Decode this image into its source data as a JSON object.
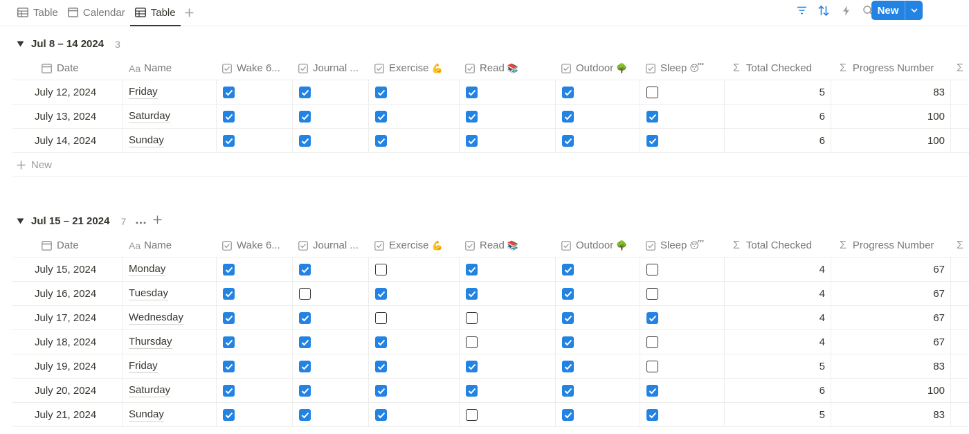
{
  "tabs": [
    {
      "label": "Table",
      "icon": "table-icon",
      "active": false
    },
    {
      "label": "Calendar",
      "icon": "calendar-icon",
      "active": false
    },
    {
      "label": "Table",
      "icon": "table-icon",
      "active": true
    }
  ],
  "toolbar": {
    "new_label": "New"
  },
  "columns": {
    "date": "Date",
    "name_prefix": "Aa",
    "name": "Name",
    "wake": "Wake 6...",
    "journal": "Journal ...",
    "exercise": "Exercise",
    "exercise_emoji": "💪",
    "read": "Read",
    "read_emoji": "📚",
    "outdoor": "Outdoor",
    "outdoor_emoji": "🌳",
    "sleep": "Sleep",
    "sleep_emoji": "😴",
    "total": "Total Checked",
    "progress": "Progress Number",
    "sigma": "Σ"
  },
  "colors": {
    "accent": "#2383e2",
    "text": "#37352f",
    "muted": "#787774",
    "border": "#ededec"
  },
  "groups": [
    {
      "title": "Jul 8 – 14 2024",
      "count": "3",
      "new_label": "New",
      "rows": [
        {
          "date": "July 12, 2024",
          "name": "Friday",
          "checks": [
            true,
            true,
            true,
            true,
            true,
            false
          ],
          "total": "5",
          "progress": "83"
        },
        {
          "date": "July 13, 2024",
          "name": "Saturday",
          "checks": [
            true,
            true,
            true,
            true,
            true,
            true
          ],
          "total": "6",
          "progress": "100"
        },
        {
          "date": "July 14, 2024",
          "name": "Sunday",
          "checks": [
            true,
            true,
            true,
            true,
            true,
            true
          ],
          "total": "6",
          "progress": "100"
        }
      ]
    },
    {
      "title": "Jul 15 – 21 2024",
      "count": "7",
      "rows": [
        {
          "date": "July 15, 2024",
          "name": "Monday",
          "checks": [
            true,
            true,
            false,
            true,
            true,
            false
          ],
          "total": "4",
          "progress": "67"
        },
        {
          "date": "July 16, 2024",
          "name": "Tuesday",
          "checks": [
            true,
            false,
            true,
            true,
            true,
            false
          ],
          "total": "4",
          "progress": "67"
        },
        {
          "date": "July 17, 2024",
          "name": "Wednesday",
          "checks": [
            true,
            true,
            false,
            false,
            true,
            true
          ],
          "total": "4",
          "progress": "67"
        },
        {
          "date": "July 18, 2024",
          "name": "Thursday",
          "checks": [
            true,
            true,
            true,
            false,
            true,
            false
          ],
          "total": "4",
          "progress": "67"
        },
        {
          "date": "July 19, 2024",
          "name": "Friday",
          "checks": [
            true,
            true,
            true,
            true,
            true,
            false
          ],
          "total": "5",
          "progress": "83"
        },
        {
          "date": "July 20, 2024",
          "name": "Saturday",
          "checks": [
            true,
            true,
            true,
            true,
            true,
            true
          ],
          "total": "6",
          "progress": "100"
        },
        {
          "date": "July 21, 2024",
          "name": "Sunday",
          "checks": [
            true,
            true,
            true,
            false,
            true,
            true
          ],
          "total": "5",
          "progress": "83"
        }
      ]
    }
  ]
}
